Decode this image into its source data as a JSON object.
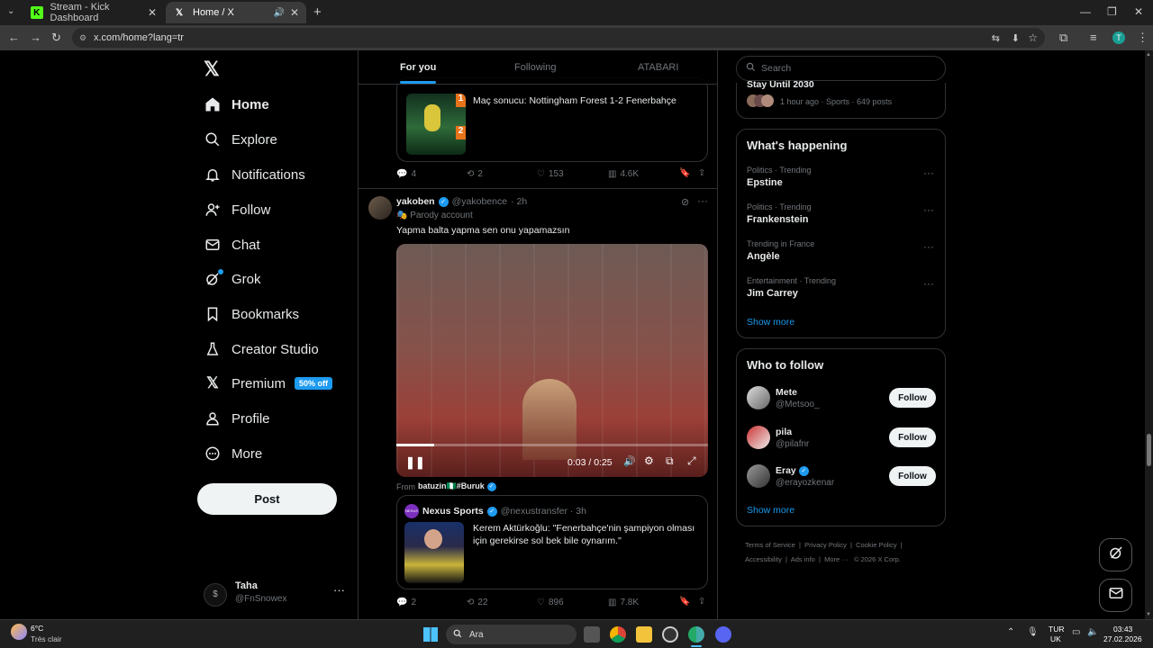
{
  "browser": {
    "tabs": [
      {
        "title": "Stream - Kick Dashboard",
        "icon": "kick-icon"
      },
      {
        "title": "Home / X",
        "icon": "x-logo-icon"
      }
    ],
    "url": "x.com/home?lang=tr"
  },
  "nav": {
    "items": [
      {
        "label": "Home",
        "icon": "home-icon"
      },
      {
        "label": "Explore",
        "icon": "search-icon"
      },
      {
        "label": "Notifications",
        "icon": "bell-icon"
      },
      {
        "label": "Follow",
        "icon": "person-add-icon"
      },
      {
        "label": "Chat",
        "icon": "mail-icon"
      },
      {
        "label": "Grok",
        "icon": "grok-icon"
      },
      {
        "label": "Bookmarks",
        "icon": "bookmark-icon"
      },
      {
        "label": "Creator Studio",
        "icon": "flask-icon"
      },
      {
        "label": "Premium",
        "icon": "x-logo-icon"
      },
      {
        "label": "Profile",
        "icon": "person-icon"
      },
      {
        "label": "More",
        "icon": "more-circle-icon"
      }
    ],
    "premium_badge": "50% off",
    "post_label": "Post",
    "user": {
      "name": "Taha",
      "handle": "@FnSnowex"
    }
  },
  "feed": {
    "tabs": [
      "For you",
      "Following",
      "ATABARI"
    ],
    "post1": {
      "quote_text": "Maç sonucu: Nottingham Forest 1-2 Fenerbahçe",
      "score_home": "1",
      "score_away": "2",
      "replies": "4",
      "reposts": "2",
      "likes": "153",
      "views": "4.6K"
    },
    "post2": {
      "name": "yakoben",
      "handle": "@yakobence",
      "time": "· 2h",
      "parody": "Parody account",
      "text": "Yapma balta yapma sen onu yapamazsın",
      "video_time": "0:03 / 0:25",
      "progress": 0.12,
      "from_label": "From",
      "from_name": "batuzin🇳🇬#Buruk",
      "quote_name": "Nexus Sports",
      "quote_handle": "@nexustransfer · 3h",
      "quote_avatar_text": "NEXUS",
      "quote_text": "Kerem Aktürkoğlu: \"Fenerbahçe'nin şampiyon olması için gerekirse sol bek bile oynarım.\"",
      "replies": "2",
      "reposts": "22",
      "likes": "896",
      "views": "7.8K"
    }
  },
  "right": {
    "search_placeholder": "Search",
    "top_card": {
      "title": "Stay Until 2030",
      "meta": "1 hour ago · Sports · 649 posts"
    },
    "happening": {
      "title": "What's happening",
      "trends": [
        {
          "meta": "Politics · Trending",
          "name": "Epstine"
        },
        {
          "meta": "Politics · Trending",
          "name": "Frankenstein"
        },
        {
          "meta": "Trending in France",
          "name": "Angèle"
        },
        {
          "meta": "Entertainment · Trending",
          "name": "Jim Carrey"
        }
      ],
      "show_more": "Show more"
    },
    "who_to_follow": {
      "title": "Who to follow",
      "users": [
        {
          "name": "Mete",
          "handle": "@Metsoo_",
          "verified": false
        },
        {
          "name": "pila",
          "handle": "@pilafnr",
          "verified": false
        },
        {
          "name": "Eray",
          "handle": "@erayozkenar",
          "verified": true
        }
      ],
      "follow_label": "Follow",
      "show_more": "Show more"
    },
    "footer": [
      "Terms of Service",
      "Privacy Policy",
      "Cookie Policy",
      "Accessibility",
      "Ads info",
      "More ···",
      "© 2026 X Corp."
    ]
  },
  "taskbar": {
    "weather_temp": "6°C",
    "weather_desc": "Très clair",
    "search": "Ara",
    "lang1": "TUR",
    "lang2": "UK",
    "time": "03:43",
    "date": "27.02.2026"
  },
  "colors": {
    "accent": "#1d9bf0",
    "bg": "#000000",
    "border": "#2f3336"
  }
}
